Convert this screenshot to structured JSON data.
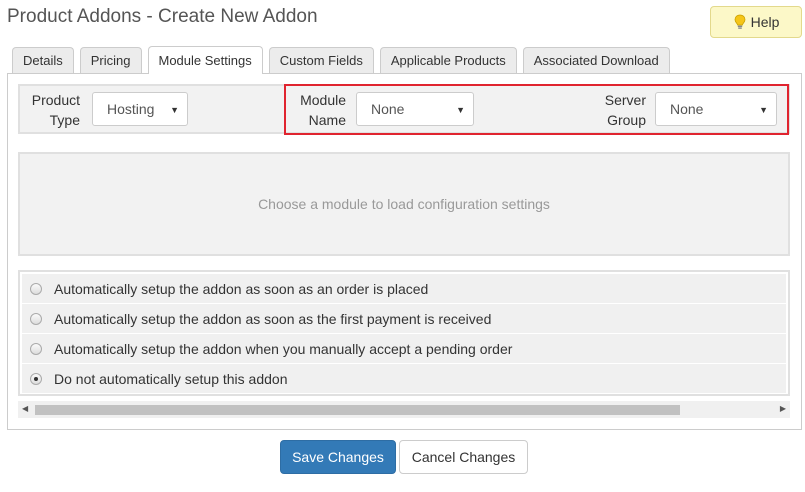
{
  "page": {
    "title": "Product Addons - Create New Addon"
  },
  "help": {
    "label": "Help",
    "icon": "lightbulb-icon"
  },
  "tabs": [
    {
      "label": "Details",
      "active": false
    },
    {
      "label": "Pricing",
      "active": false
    },
    {
      "label": "Module Settings",
      "active": true
    },
    {
      "label": "Custom Fields",
      "active": false
    },
    {
      "label": "Applicable Products",
      "active": false
    },
    {
      "label": "Associated Download",
      "active": false
    }
  ],
  "settings": {
    "product_type": {
      "label_line1": "Product",
      "label_line2": "Type",
      "value": "Hosting"
    },
    "module_name": {
      "label_line1": "Module",
      "label_line2": "Name",
      "value": "None"
    },
    "server_group": {
      "label_line1": "Server",
      "label_line2": "Group",
      "value": "None"
    }
  },
  "module_area": {
    "placeholder": "Choose a module to load configuration settings"
  },
  "setup_options": [
    {
      "label": "Automatically setup the addon as soon as an order is placed",
      "checked": false
    },
    {
      "label": "Automatically setup the addon as soon as the first payment is received",
      "checked": false
    },
    {
      "label": "Automatically setup the addon when you manually accept a pending order",
      "checked": false
    },
    {
      "label": "Do not automatically setup this addon",
      "checked": true
    }
  ],
  "actions": {
    "save": "Save Changes",
    "cancel": "Cancel Changes"
  },
  "colors": {
    "primary": "#337ab7",
    "highlight": "#e0242f",
    "help_bg": "#fcf8c8"
  }
}
